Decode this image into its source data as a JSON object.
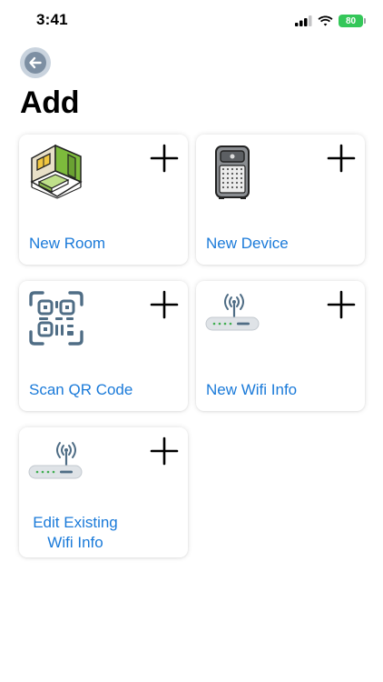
{
  "status_bar": {
    "time": "3:41",
    "battery_level": "80",
    "signal_icon": "cellular-signal-icon",
    "wifi_icon": "wifi-icon"
  },
  "header": {
    "back_icon": "back-arrow-icon",
    "title": "Add"
  },
  "cards": [
    {
      "label": "New Room",
      "icon": "room-icon"
    },
    {
      "label": "New Device",
      "icon": "air-purifier-icon"
    },
    {
      "label": "Scan QR Code",
      "icon": "qr-code-icon"
    },
    {
      "label": "New Wifi Info",
      "icon": "wifi-router-icon"
    },
    {
      "label_line1": "Edit Existing",
      "label_line2": "Wifi Info",
      "icon": "wifi-router-icon"
    }
  ],
  "colors": {
    "accent": "#1a7ad9",
    "battery": "#34c759",
    "back_button": "#7d8fa3"
  }
}
